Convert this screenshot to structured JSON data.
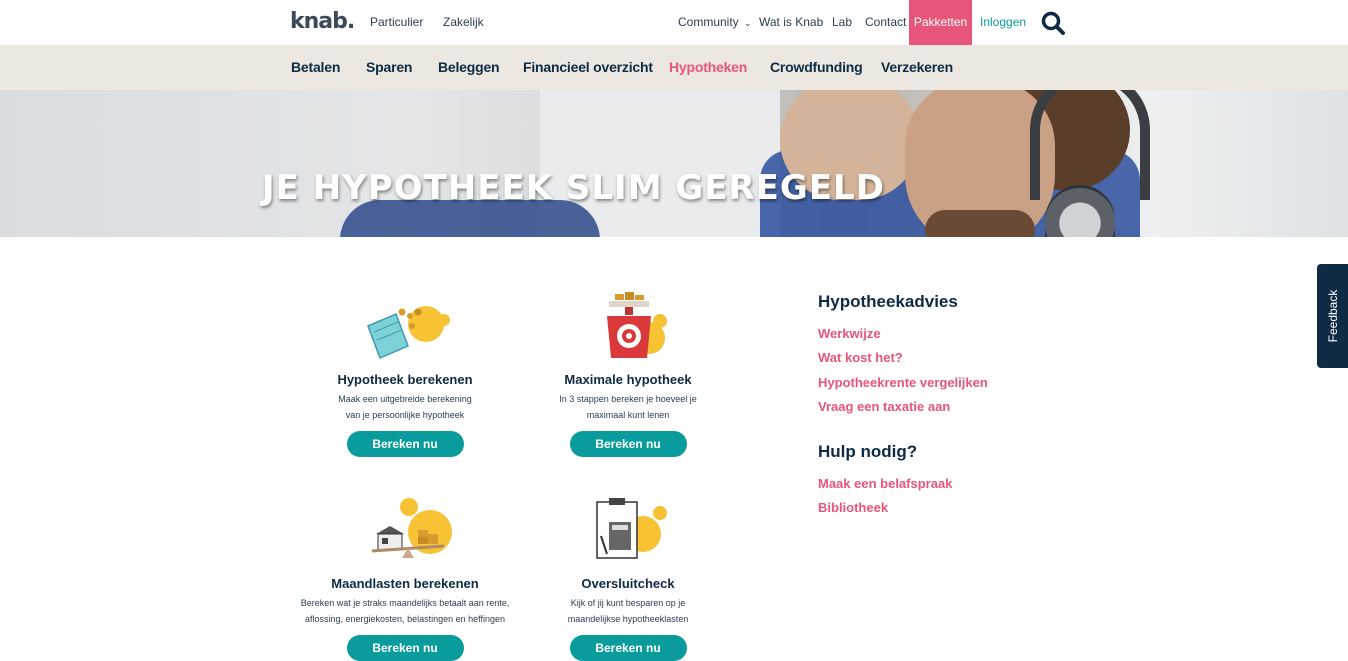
{
  "header": {
    "logo": "knab.",
    "links": [
      "Particulier",
      "Zakelijk"
    ],
    "right_links": [
      "Community",
      "Wat is Knab",
      "Lab",
      "Contact"
    ],
    "pakketten": "Pakketten",
    "inloggen": "Inloggen",
    "search_icon": "search-icon"
  },
  "nav": {
    "items": [
      "Betalen",
      "Sparen",
      "Beleggen",
      "Financieel overzicht",
      "Hypotheken",
      "Crowdfunding",
      "Verzekeren"
    ],
    "active": "Hypotheken"
  },
  "hero": {
    "title": "JE HYPOTHEEK SLIM GEREGELD"
  },
  "cards": [
    {
      "title": "Hypotheek berekenen",
      "description_line1": "Maak een uitgebreide berekening",
      "description_line2": "van je persoonlijke hypotheek",
      "button": "Bereken nu",
      "icon": "calculator-money-icon"
    },
    {
      "title": "Maximale hypotheek",
      "description_line1": "In 3 stappen bereken je hoeveel je",
      "description_line2": "maximaal kunt lenen",
      "button": "Bereken nu",
      "icon": "scale-coins-icon"
    },
    {
      "title": "Maandlasten berekenen",
      "description_line1": "Bereken wat je straks maandelijks betaalt aan rente,",
      "description_line2": "aflossing, energiekosten, belastingen en heffingen",
      "button": "Bereken nu",
      "icon": "house-coins-seesaw-icon"
    },
    {
      "title": "Oversluitcheck",
      "description_line1": "Kijk of jij kunt besparen op je",
      "description_line2": "maandelijkse hypotheeklasten",
      "button": "Bereken nu",
      "icon": "clipboard-calculator-icon"
    }
  ],
  "sidebar": {
    "advies_title": "Hypotheekadvies",
    "advies_links": [
      "Werkwijze",
      "Wat kost het?",
      "Hypotheekrente vergelijken",
      "Vraag een taxatie aan"
    ],
    "hulp_title": "Hulp nodig?",
    "hulp_links": [
      "Maak een belafspraak",
      "Bibliotheek"
    ]
  },
  "feedback": "Feedback",
  "colors": {
    "accent_pink": "#e8557a",
    "accent_teal": "#0a9c9c",
    "navy": "#0d2b45",
    "nav_bg": "#ece7e0",
    "yellow": "#f7c234"
  }
}
